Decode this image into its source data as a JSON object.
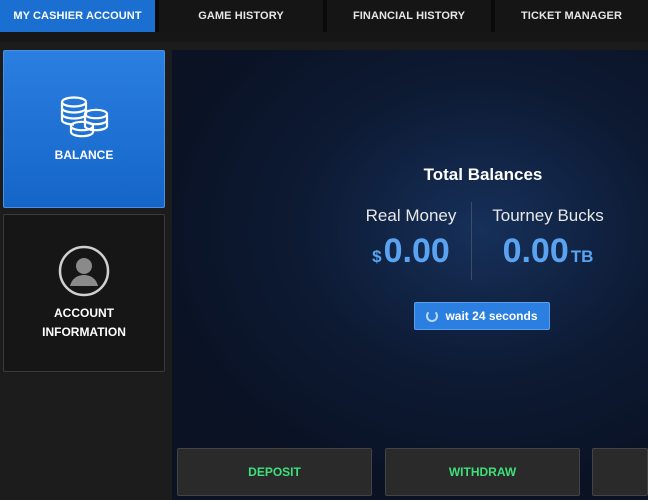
{
  "tabs": [
    {
      "label": "MY CASHIER ACCOUNT",
      "active": true
    },
    {
      "label": "GAME HISTORY",
      "active": false
    },
    {
      "label": "FINANCIAL HISTORY",
      "active": false
    },
    {
      "label": "TICKET MANAGER",
      "active": false
    }
  ],
  "sidebar": {
    "items": [
      {
        "label": "BALANCE",
        "icon": "coins-icon",
        "active": true
      },
      {
        "label": "ACCOUNT\nINFORMATION",
        "icon": "user-circle-icon",
        "active": false
      }
    ]
  },
  "main": {
    "title": "Total Balances",
    "real_money": {
      "label": "Real Money",
      "currency": "$",
      "value": "0.00"
    },
    "tourney_bucks": {
      "label": "Tourney Bucks",
      "value": "0.00",
      "unit": "TB"
    },
    "wait_button": "wait 24 seconds"
  },
  "actions": {
    "deposit": "DEPOSIT",
    "withdraw": "WITHDRAW",
    "third": ""
  },
  "colors": {
    "accent": "#2a7fe0",
    "balance_text": "#5aa3f0",
    "action_text": "#3ee07a"
  }
}
